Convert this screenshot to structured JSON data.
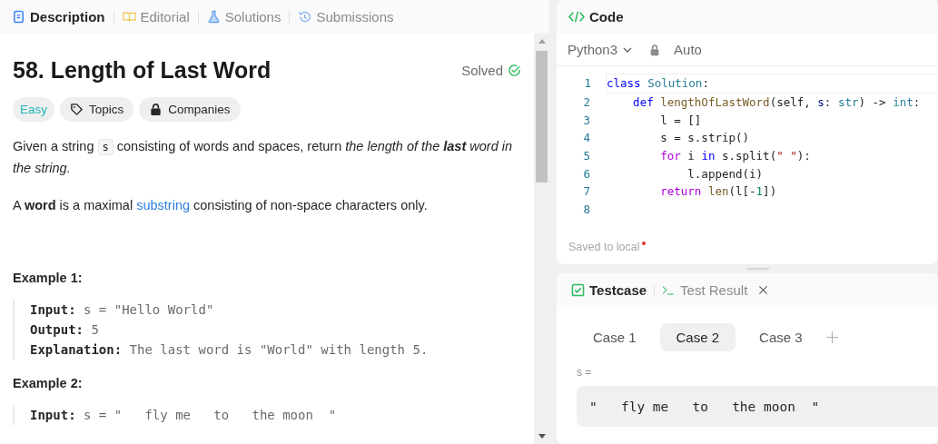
{
  "left_tabs": [
    {
      "label": "Description",
      "selected": true
    },
    {
      "label": "Editorial",
      "selected": false
    },
    {
      "label": "Solutions",
      "selected": false
    },
    {
      "label": "Submissions",
      "selected": false
    }
  ],
  "problem": {
    "title": "58. Length of Last Word",
    "status": "Solved",
    "tags": [
      {
        "label": "Easy",
        "kind": "difficulty"
      },
      {
        "label": "Topics",
        "kind": "topics"
      },
      {
        "label": "Companies",
        "kind": "companies"
      }
    ],
    "paragraphs": [
      [
        {
          "kind": "text",
          "text": "Given a string "
        },
        {
          "kind": "code",
          "text": "s"
        },
        {
          "kind": "text",
          "text": " consisting of words and spaces, return "
        },
        {
          "kind": "italic",
          "text": "the length of the "
        },
        {
          "kind": "bolditalic",
          "text": "last"
        },
        {
          "kind": "italic",
          "text": " word in the string."
        }
      ],
      [
        {
          "kind": "text",
          "text": "A "
        },
        {
          "kind": "bold",
          "text": "word"
        },
        {
          "kind": "text",
          "text": " is a maximal "
        },
        {
          "kind": "link",
          "text": "substring"
        },
        {
          "kind": "text",
          "text": " consisting of non-space characters only."
        }
      ]
    ],
    "examples": [
      {
        "title": "Example 1:",
        "lines": [
          {
            "label": "Input:",
            "value": "s = \"Hello World\""
          },
          {
            "label": "Output:",
            "value": "5"
          },
          {
            "label": "Explanation:",
            "value": "The last word is \"World\" with length 5."
          }
        ]
      },
      {
        "title": "Example 2:",
        "lines": [
          {
            "label": "Input:",
            "value": "s = \"   fly me   to   the moon  \""
          }
        ]
      }
    ]
  },
  "code_panel": {
    "title": "Code",
    "language": "Python3",
    "mode": "Auto",
    "save_status": "Saved to local",
    "lines": [
      {
        "number": "1",
        "tokens": [
          {
            "kind": "keyword",
            "text": "class"
          },
          {
            "kind": "type",
            "text": " Solution"
          },
          {
            "kind": "plain",
            "text": ":"
          }
        ]
      },
      {
        "number": "2",
        "tokens": [
          {
            "kind": "keyword",
            "text": "    def"
          },
          {
            "kind": "function",
            "text": " lengthOfLastWord"
          },
          {
            "kind": "plain",
            "text": "(self, "
          },
          {
            "kind": "param",
            "text": "s"
          },
          {
            "kind": "plain",
            "text": ": "
          },
          {
            "kind": "type",
            "text": "str"
          },
          {
            "kind": "plain",
            "text": ") -> "
          },
          {
            "kind": "type",
            "text": "int"
          },
          {
            "kind": "plain",
            "text": ":"
          }
        ]
      },
      {
        "number": "3",
        "tokens": [
          {
            "kind": "plain",
            "text": "        l = []"
          }
        ]
      },
      {
        "number": "4",
        "tokens": [
          {
            "kind": "plain",
            "text": "        s = s.strip()"
          }
        ]
      },
      {
        "number": "5",
        "tokens": [
          {
            "kind": "control",
            "text": "        for"
          },
          {
            "kind": "plain",
            "text": " i "
          },
          {
            "kind": "keyword",
            "text": "in"
          },
          {
            "kind": "plain",
            "text": " s.split("
          },
          {
            "kind": "string",
            "text": "\" \""
          },
          {
            "kind": "plain",
            "text": "):"
          }
        ]
      },
      {
        "number": "6",
        "tokens": [
          {
            "kind": "plain",
            "text": "            l.append(i)"
          }
        ]
      },
      {
        "number": "7",
        "tokens": [
          {
            "kind": "control",
            "text": "        return"
          },
          {
            "kind": "function",
            "text": " len"
          },
          {
            "kind": "plain",
            "text": "(l[-"
          },
          {
            "kind": "number",
            "text": "1"
          },
          {
            "kind": "plain",
            "text": "])"
          }
        ]
      },
      {
        "number": "8"
      }
    ]
  },
  "test_panel": {
    "tabs": [
      {
        "label": "Testcase",
        "selected": true
      },
      {
        "label": "Test Result",
        "selected": false
      }
    ],
    "cases": [
      {
        "label": "Case 1",
        "selected": false
      },
      {
        "label": "Case 2",
        "selected": true
      },
      {
        "label": "Case 3",
        "selected": false
      }
    ],
    "input_label": "s =",
    "input_value": "\"   fly me   to   the moon  \""
  }
}
